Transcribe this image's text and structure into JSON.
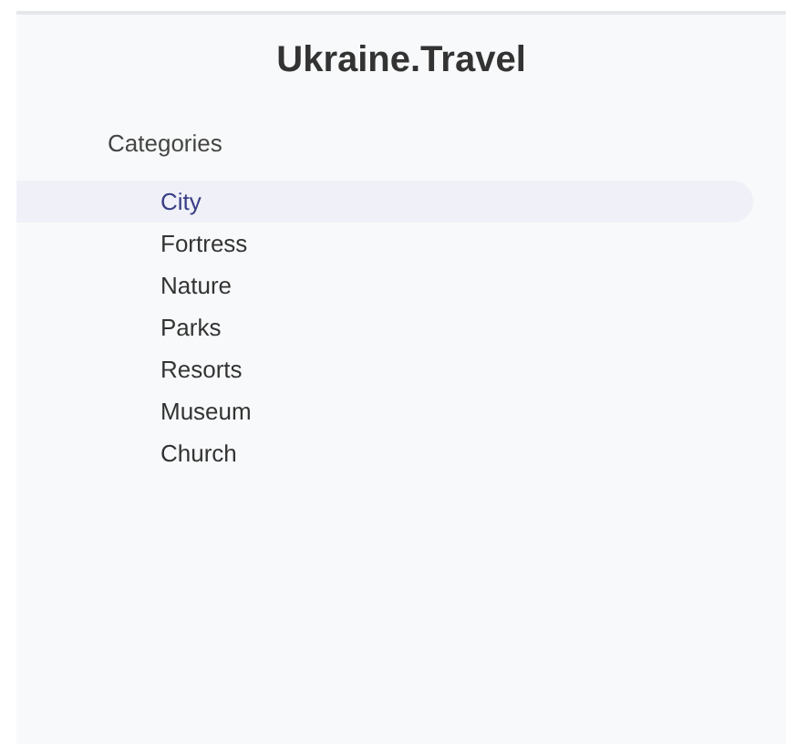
{
  "sidebar": {
    "title": "Ukraine.Travel",
    "heading": "Categories",
    "items": [
      {
        "label": "City",
        "selected": true
      },
      {
        "label": "Fortress",
        "selected": false
      },
      {
        "label": "Nature",
        "selected": false
      },
      {
        "label": "Parks",
        "selected": false
      },
      {
        "label": "Resorts",
        "selected": false
      },
      {
        "label": "Museum",
        "selected": false
      },
      {
        "label": "Church",
        "selected": false
      }
    ]
  }
}
